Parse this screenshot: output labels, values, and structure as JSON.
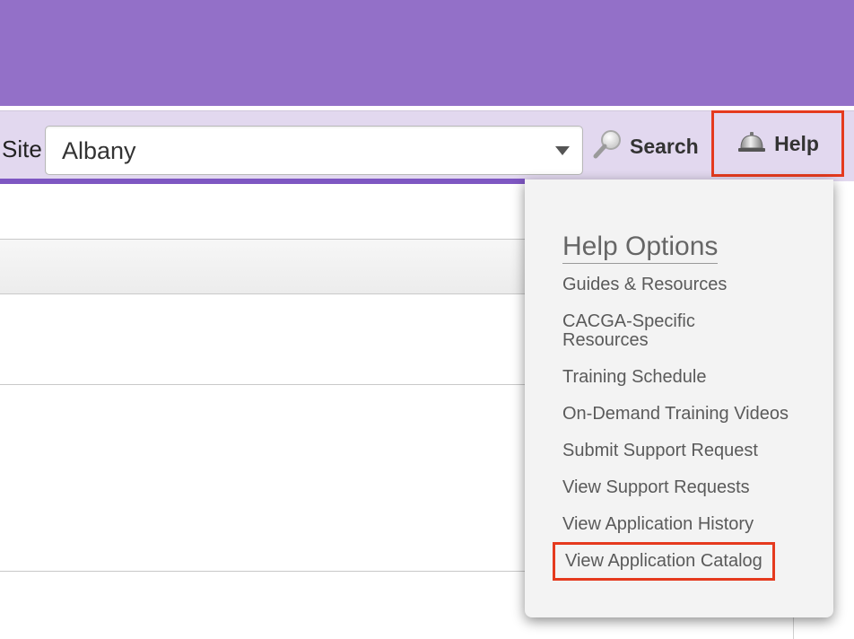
{
  "toolbar": {
    "site_label": "Site",
    "site_value": "Albany",
    "search_label": "Search",
    "help_label": "Help"
  },
  "help_menu": {
    "title": "Help Options",
    "items": [
      {
        "label": "Guides & Resources"
      },
      {
        "label": "CACGA-Specific Resources"
      },
      {
        "label": "Training Schedule"
      },
      {
        "label": "On-Demand Training Videos"
      },
      {
        "label": "Submit Support Request"
      },
      {
        "label": "View Support Requests"
      },
      {
        "label": "View Application History"
      },
      {
        "label": "View Application Catalog"
      }
    ]
  },
  "colors": {
    "banner": "#9370c8",
    "toolbar": "#e2d8ef",
    "accent": "#7e57c2",
    "highlight": "#e53a1e"
  },
  "icons": [
    "magnifier-icon",
    "bell-icon",
    "chevron-down-icon"
  ]
}
